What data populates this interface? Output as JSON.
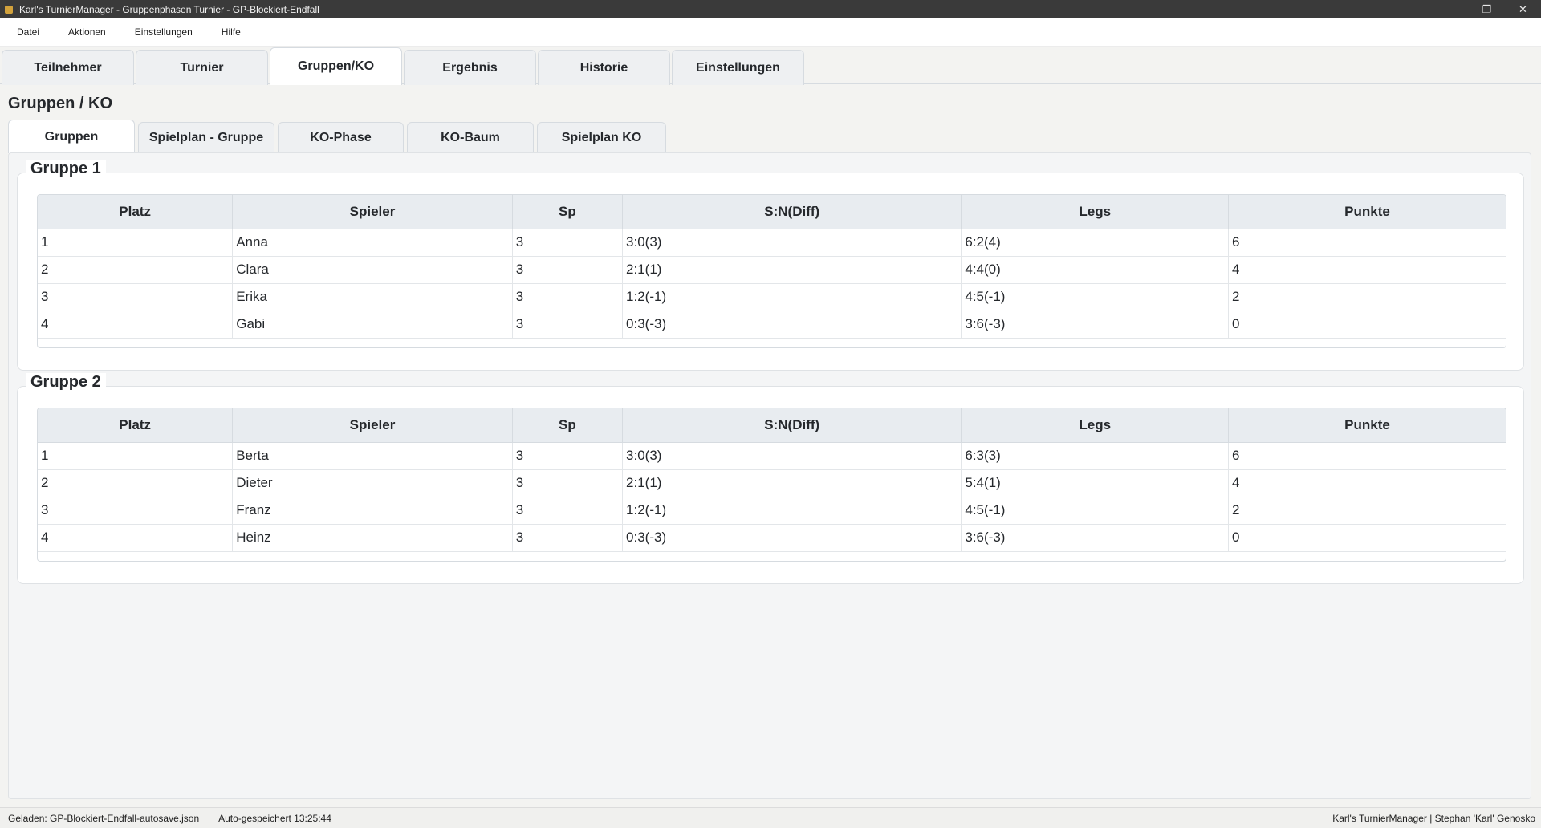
{
  "window": {
    "title": "Karl's TurnierManager - Gruppenphasen Turnier - GP-Blockiert-Endfall",
    "controls": {
      "minimize": "—",
      "maximize": "❐",
      "close": "✕"
    }
  },
  "menu": [
    "Datei",
    "Aktionen",
    "Einstellungen",
    "Hilfe"
  ],
  "main_tabs": [
    {
      "label": "Teilnehmer",
      "active": false
    },
    {
      "label": "Turnier",
      "active": false
    },
    {
      "label": "Gruppen/KO",
      "active": true
    },
    {
      "label": "Ergebnis",
      "active": false
    },
    {
      "label": "Historie",
      "active": false
    },
    {
      "label": "Einstellungen",
      "active": false
    }
  ],
  "page_title": "Gruppen / KO",
  "sub_tabs": [
    {
      "label": "Gruppen",
      "active": true
    },
    {
      "label": "Spielplan - Gruppe",
      "active": false
    },
    {
      "label": "KO-Phase",
      "active": false
    },
    {
      "label": "KO-Baum",
      "active": false
    },
    {
      "label": "Spielplan KO",
      "active": false
    }
  ],
  "columns": [
    "Platz",
    "Spieler",
    "Sp",
    "S:N(Diff)",
    "Legs",
    "Punkte"
  ],
  "groups": [
    {
      "title": "Gruppe 1",
      "rows": [
        [
          "1",
          "Anna",
          "3",
          "3:0(3)",
          "6:2(4)",
          "6"
        ],
        [
          "2",
          "Clara",
          "3",
          "2:1(1)",
          "4:4(0)",
          "4"
        ],
        [
          "3",
          "Erika",
          "3",
          "1:2(-1)",
          "4:5(-1)",
          "2"
        ],
        [
          "4",
          "Gabi",
          "3",
          "0:3(-3)",
          "3:6(-3)",
          "0"
        ]
      ]
    },
    {
      "title": "Gruppe 2",
      "rows": [
        [
          "1",
          "Berta",
          "3",
          "3:0(3)",
          "6:3(3)",
          "6"
        ],
        [
          "2",
          "Dieter",
          "3",
          "2:1(1)",
          "5:4(1)",
          "4"
        ],
        [
          "3",
          "Franz",
          "3",
          "1:2(-1)",
          "4:5(-1)",
          "2"
        ],
        [
          "4",
          "Heinz",
          "3",
          "0:3(-3)",
          "3:6(-3)",
          "0"
        ]
      ]
    }
  ],
  "status": {
    "loaded": "Geladen: GP-Blockiert-Endfall-autosave.json",
    "autosave": "Auto-gespeichert 13:25:44",
    "right": "Karl's TurnierManager | Stephan 'Karl' Genosko"
  }
}
